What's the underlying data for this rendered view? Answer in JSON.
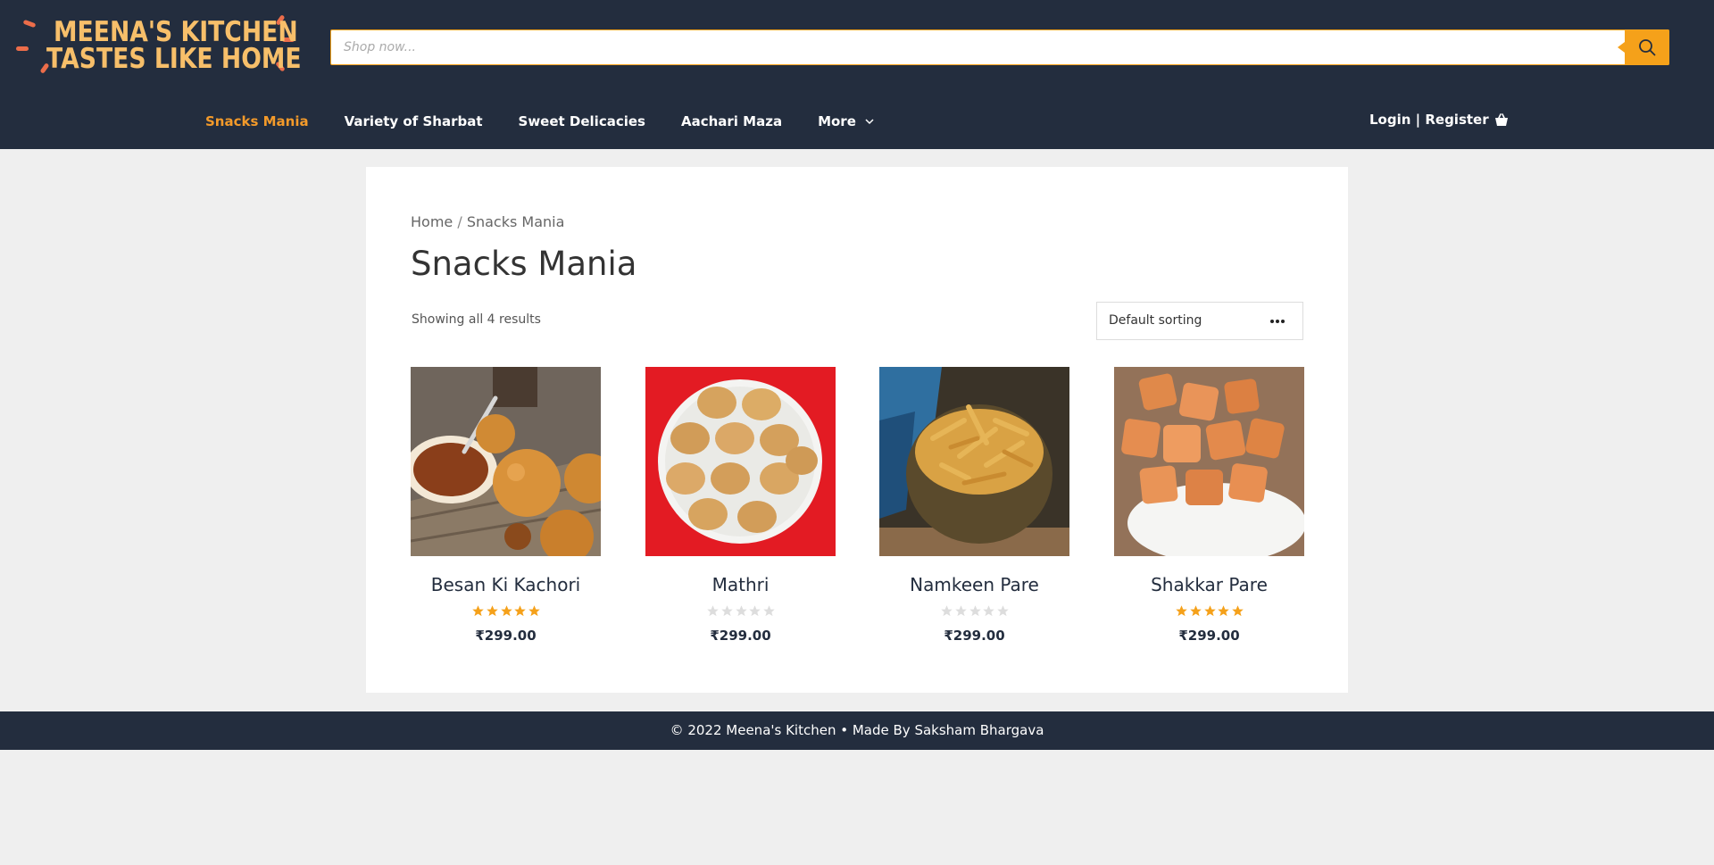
{
  "brand": {
    "logo_line1": "MEENA'S KITCHEN",
    "logo_line2": "TASTES LIKE HOME",
    "logo_text_color": "#f7bf6a",
    "logo_accent_color": "#ec6d4a"
  },
  "colors": {
    "header_bg": "#232d3e",
    "accent": "#f5a11a",
    "active_nav": "#f39a2a",
    "page_bg": "#efefef",
    "star_filled": "#f5a11a",
    "star_empty": "#dddddd"
  },
  "search": {
    "placeholder": "Shop now...",
    "value": "",
    "button_icon": "search-icon"
  },
  "nav": {
    "items": [
      {
        "label": "Snacks Mania",
        "active": true
      },
      {
        "label": "Variety of Sharbat",
        "active": false
      },
      {
        "label": "Sweet Delicacies",
        "active": false
      },
      {
        "label": "Aachari Maza",
        "active": false
      },
      {
        "label": "More",
        "active": false,
        "icon": "chevron-down-icon"
      }
    ],
    "login_label": "Login | Register",
    "cart_icon": "shopping-basket-icon"
  },
  "breadcrumb": {
    "home": "Home",
    "separator": " / ",
    "current": "Snacks Mania"
  },
  "page": {
    "title": "Snacks Mania",
    "result_count": "Showing all 4 results",
    "sorting": {
      "selected": "Default sorting",
      "icon": "more-dots-icon"
    }
  },
  "products": [
    {
      "name": "Besan Ki Kachori",
      "price": "₹299.00",
      "rating": 5,
      "image": "kachori-photo"
    },
    {
      "name": "Mathri",
      "price": "₹299.00",
      "rating": 0,
      "image": "mathri-photo"
    },
    {
      "name": "Namkeen Pare",
      "price": "₹299.00",
      "rating": 0,
      "image": "namkeen-pare-photo"
    },
    {
      "name": "Shakkar Pare",
      "price": "₹299.00",
      "rating": 5,
      "image": "shakkar-pare-photo"
    }
  ],
  "footer": {
    "text": "© 2022 Meena's Kitchen • Made By Saksham Bhargava"
  }
}
